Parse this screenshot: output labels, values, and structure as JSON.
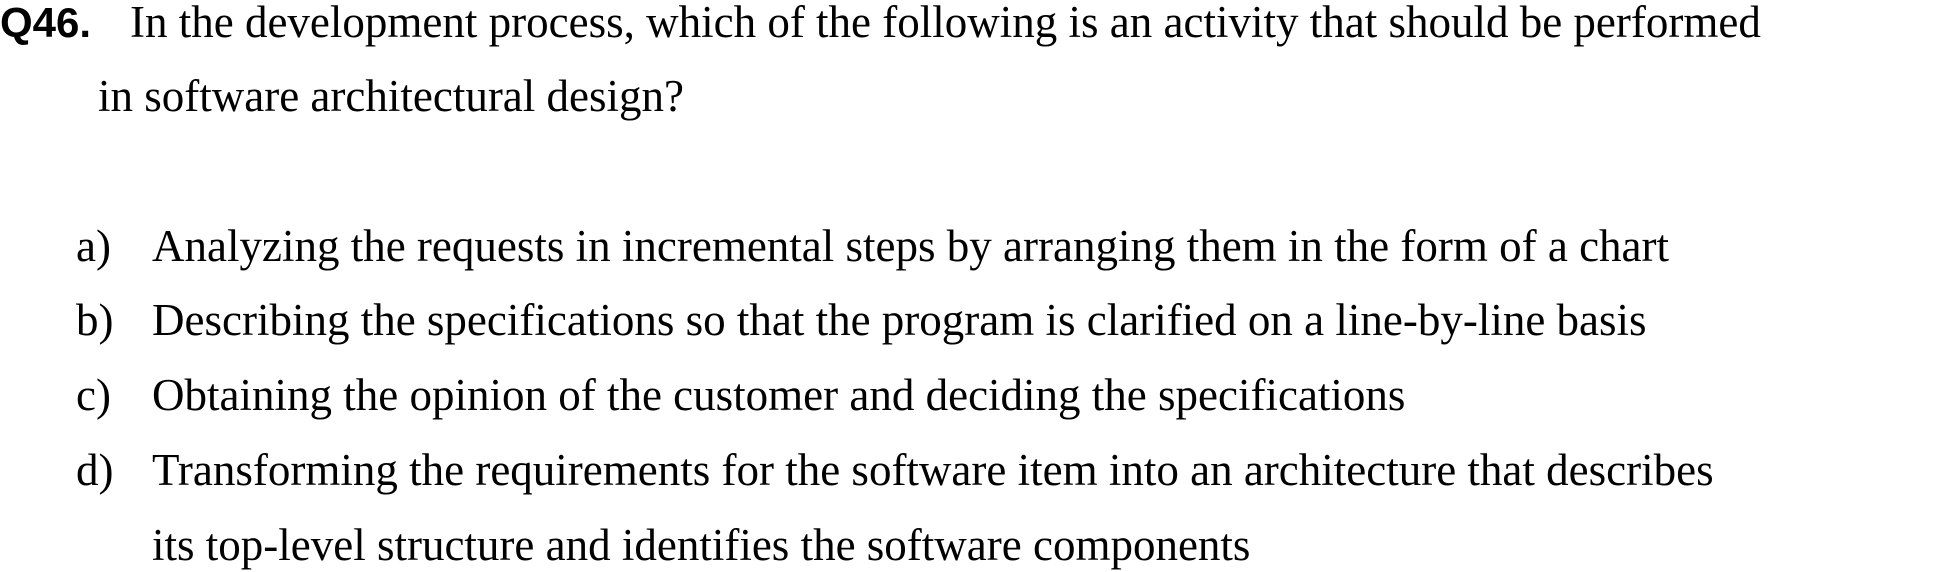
{
  "question": {
    "number": "Q46.",
    "text_line_1": "In the development process, which of the following is an activity that should be performed",
    "text_line_2": "in software architectural design?"
  },
  "options": [
    {
      "label": "a)",
      "text": "Analyzing the requests in incremental steps by arranging them in the form of a chart"
    },
    {
      "label": "b)",
      "text": "Describing the specifications so that the program is clarified on a line-by-line basis"
    },
    {
      "label": "c)",
      "text": "Obtaining the opinion of the customer and deciding the specifications"
    },
    {
      "label": "d)",
      "text_line_1": "Transforming the requirements for the software item into an architecture that describes",
      "text_line_2": "its top-level structure and identifies the software components"
    }
  ]
}
